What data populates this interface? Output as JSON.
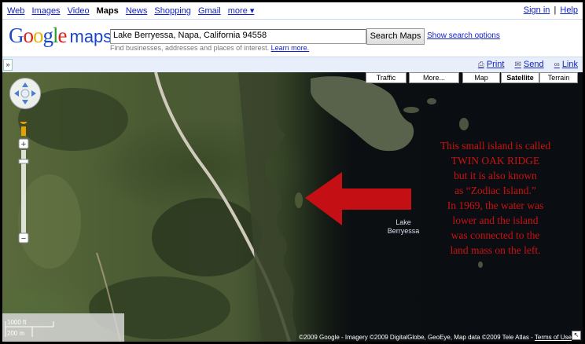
{
  "topnav": {
    "links": [
      "Web",
      "Images",
      "Video",
      "Maps",
      "News",
      "Shopping",
      "Gmail",
      "more ▾"
    ],
    "active": "Maps",
    "signin": "Sign in",
    "separator": "|",
    "help": "Help"
  },
  "logo": {
    "g": "G",
    "o1": "o",
    "o2": "o",
    "g2": "g",
    "l": "l",
    "e": "e",
    "product": "maps"
  },
  "search": {
    "value": "Lake Berryessa, Napa, California 94558",
    "button": "Search Maps",
    "options_link": "Show search options",
    "hint": "Find businesses, addresses and places of interest.",
    "learn_more": "Learn more."
  },
  "toolbar": {
    "collapse_label": "»",
    "print": "Print",
    "send": "Send",
    "link": "Link",
    "icons": [
      "printer-icon",
      "envelope-icon",
      "link-icon"
    ]
  },
  "map": {
    "type_buttons": [
      "Traffic",
      "More...",
      "Map",
      "Satellite",
      "Terrain"
    ],
    "selected_type": "Satellite",
    "lake_label": "Lake\nBerryessa",
    "annotation": "This small island is called TWIN OAK RIDGE but it is also known as “Zodiac Island.” In 1969, the water was lower and the island was connected to the land mass on the left.",
    "annotation_lines": [
      "This small island is called",
      "TWIN OAK RIDGE",
      "but it is also known",
      "as “Zodiac Island.”",
      "In 1969, the water was",
      "lower and the island",
      "was connected to the",
      "land mass on the left."
    ],
    "scale_top": "1000 ft",
    "scale_bottom": "200 m",
    "copyright": "©2009 Google - Imagery ©2009 DigitalGlobe, GeoEye, Map data ©2009 Tele Atlas -",
    "terms": "Terms of Use",
    "colors": {
      "annotation": "#cc1111",
      "arrow": "#c40f14",
      "water": "#0a0e12",
      "link": "#1122cc"
    }
  }
}
